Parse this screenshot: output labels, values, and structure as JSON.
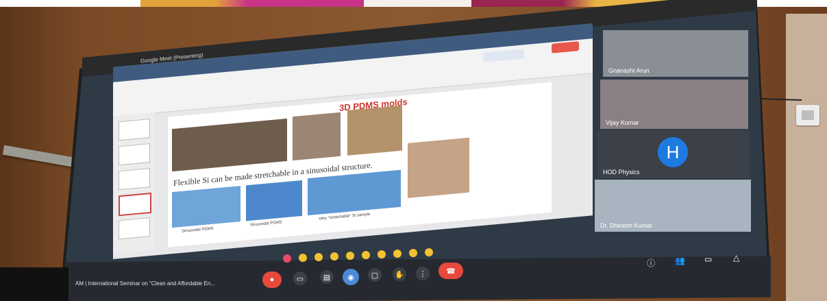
{
  "window": {
    "title": "Google Meet (Presenting)"
  },
  "slide": {
    "title": "3D PDMS molds",
    "bullet": "Flexible Si can be made stretchable in a sinusoidal structure.",
    "captions": [
      "Sinusoidal PDMS",
      "Sinusoidal PDMS",
      "Very \"stretchable\" Si sample"
    ]
  },
  "participants": [
    {
      "label": "Gnanashi Arun"
    },
    {
      "label": "Vijay Kumar"
    },
    {
      "label": "HOD Physics",
      "avatar": "H"
    },
    {
      "label": "Dr. Dhinesh Kumar"
    }
  ],
  "meeting": {
    "title": "AM | International Seminar on \"Clean and Affordable En..."
  },
  "colors": {
    "accent": "#1d7ae0",
    "end_call": "#e8493c",
    "slide_title": "#d0342c"
  },
  "icons": [
    "mic-icon",
    "camera-icon",
    "captions-icon",
    "present-icon",
    "more-icon",
    "end-call-icon",
    "info-icon",
    "people-icon",
    "chat-icon",
    "activities-icon"
  ]
}
